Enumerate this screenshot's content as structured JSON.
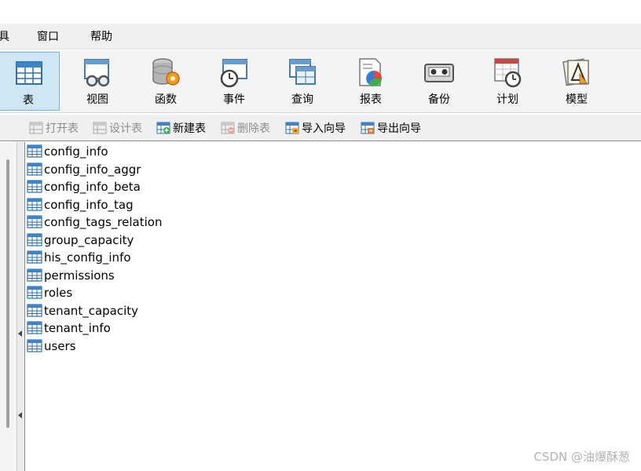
{
  "menu": {
    "items": [
      "具",
      "窗口",
      "帮助"
    ]
  },
  "toolbar": {
    "items": [
      {
        "label": "表",
        "icon": "table-icon",
        "active": true
      },
      {
        "label": "视图",
        "icon": "view-icon"
      },
      {
        "label": "函数",
        "icon": "function-icon"
      },
      {
        "label": "事件",
        "icon": "event-icon"
      },
      {
        "label": "查询",
        "icon": "query-icon"
      },
      {
        "label": "报表",
        "icon": "report-icon"
      },
      {
        "label": "备份",
        "icon": "backup-icon"
      },
      {
        "label": "计划",
        "icon": "schedule-icon"
      },
      {
        "label": "模型",
        "icon": "model-icon"
      }
    ]
  },
  "object_toolbar": {
    "open": "打开表",
    "design": "设计表",
    "new": "新建表",
    "delete": "删除表",
    "import": "导入向导",
    "export": "导出向导"
  },
  "tables": [
    "config_info",
    "config_info_aggr",
    "config_info_beta",
    "config_info_tag",
    "config_tags_relation",
    "group_capacity",
    "his_config_info",
    "permissions",
    "roles",
    "tenant_capacity",
    "tenant_info",
    "users"
  ],
  "watermark": "CSDN @油爆酥葱",
  "colors": {
    "active_tool_bg": "#cfe6f7",
    "active_tool_border": "#7ab6e2",
    "disabled_text": "#8d8d8d"
  }
}
